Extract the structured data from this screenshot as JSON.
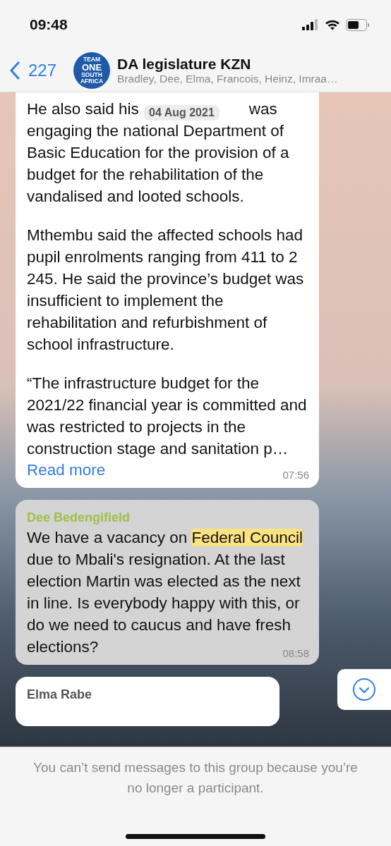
{
  "status_bar": {
    "time": "09:48"
  },
  "header": {
    "back_count": "227",
    "avatar_lines": [
      "TEAM",
      "ONE",
      "SOUTH",
      "AFRICA"
    ],
    "title": "DA legislature KZN",
    "subtitle": "Bradley, Dee, Elma, Francois, Heinz, Imraa…"
  },
  "date_pill": "04 Aug 2021",
  "messages": [
    {
      "kind": "article",
      "highlighted": false,
      "first_line": [
        "He also said his",
        "was"
      ],
      "paragraphs": [
        "engaging the national Department of Basic Education for the provision of a budget for the rehabilitation of the vandalised and looted schools.",
        "Mthembu said the affected schools had pupil enrolments ranging from 411 to 2 245. He said the province’s budget was insufficient to implement the rehabilitation and refurbishment of school infrastructure.",
        "“The infrastructure budget for the 2021/22 financial year is committed and was restricted to projects in the construction stage and sanitation p…"
      ],
      "link": "Read more",
      "time": "07:56"
    },
    {
      "kind": "text",
      "highlighted": true,
      "sender": "Dee Bedengifield",
      "color": "#9dc14a",
      "segments": [
        {
          "text": "We have a vacancy on ",
          "highlight": false
        },
        {
          "text": "Federal Council",
          "highlight": true
        },
        {
          "text": " due to Mbali's resignation. At the last election Martin was elected as the next in line.  Is everybody happy with this, or do we need to caucus and have fresh elections?",
          "highlight": false
        }
      ],
      "time": "08:58"
    },
    {
      "kind": "partial",
      "highlighted": false,
      "sender": "Elma Rabe",
      "color": "#555555"
    }
  ],
  "footer": {
    "notice": "You can’t send messages to this group because you’re no longer a participant."
  }
}
